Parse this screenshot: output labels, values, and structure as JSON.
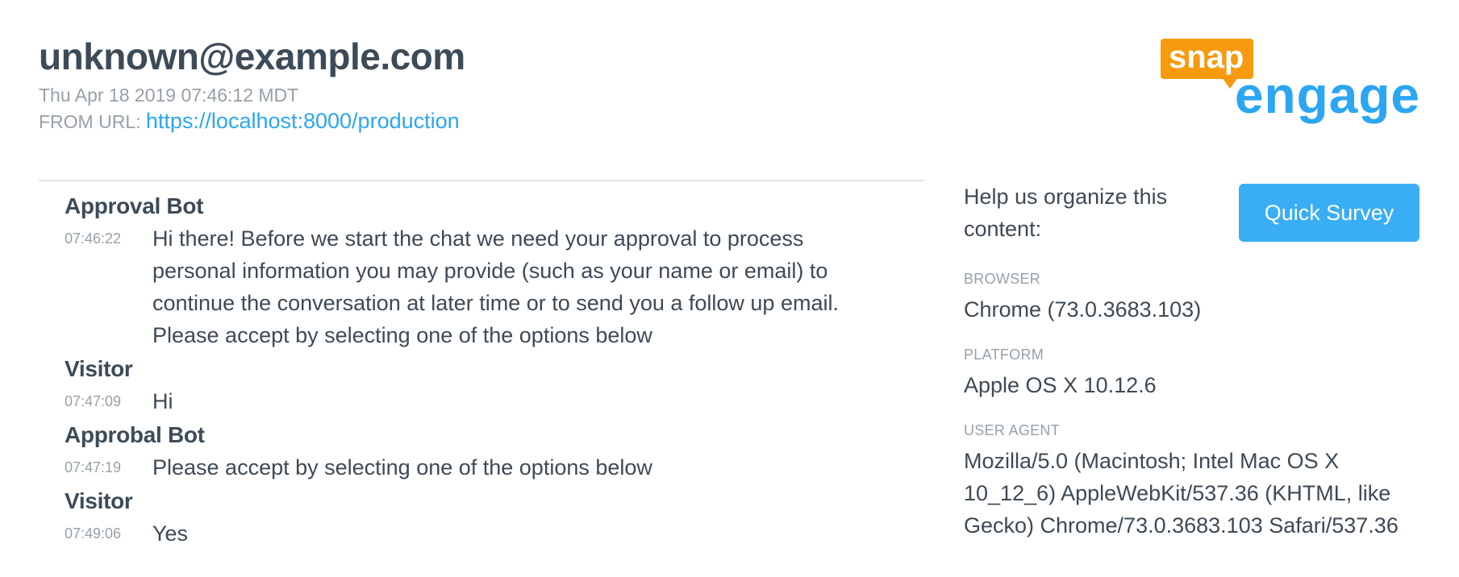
{
  "header": {
    "title": "unknown@example.com",
    "date": "Thu Apr 18 2019 07:46:12 MDT",
    "from_url_label": "FROM URL:",
    "from_url": "https://localhost:8000/production"
  },
  "logo": {
    "snap": "snap",
    "engage": "engage",
    "colors": {
      "snap": "#f79a0e",
      "engage": "#2ba6f3"
    }
  },
  "transcript": [
    {
      "speaker": "Approval Bot",
      "time": "07:46:22",
      "text": "Hi there! Before we start the chat we need your approval to process personal information you may provide (such as your name or email) to continue the conversation at later time or to send you a follow up email. Please accept by selecting one of the options below"
    },
    {
      "speaker": "Visitor",
      "time": "07:47:09",
      "text": "Hi"
    },
    {
      "speaker": "Approbal Bot",
      "time": "07:47:19",
      "text": "Please accept by selecting one of the options below"
    },
    {
      "speaker": "Visitor",
      "time": "07:49:06",
      "text": "Yes"
    }
  ],
  "sidebar": {
    "help_text": "Help us organize this content:",
    "survey_button": "Quick Survey",
    "browser_label": "BROWSER",
    "browser_value": "Chrome (73.0.3683.103)",
    "platform_label": "PLATFORM",
    "platform_value": "Apple OS X 10.12.6",
    "user_agent_label": "USER AGENT",
    "user_agent_value": "Mozilla/5.0 (Macintosh; Intel Mac OS X 10_12_6) AppleWebKit/537.36 (KHTML, like Gecko) Chrome/73.0.3683.103 Safari/537.36"
  },
  "colors": {
    "accent": "#2ba6f3",
    "button": "#3aaef5",
    "text": "#3e4a55",
    "muted": "#97a0a8"
  }
}
